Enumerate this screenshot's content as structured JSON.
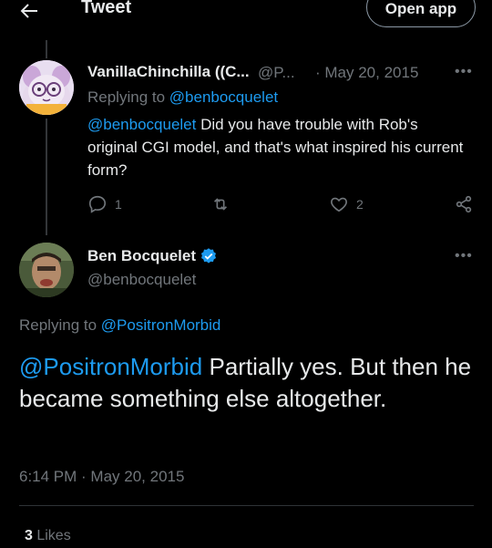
{
  "header": {
    "title": "Tweet",
    "open_app_label": "Open app"
  },
  "reply_tweet": {
    "author_name": "VanillaChinchilla ((C...",
    "author_handle": "@P...",
    "date": "· May 20, 2015",
    "replying_prefix": "Replying to ",
    "replying_to": "@benbocquelet",
    "text_mention": "@benbocquelet",
    "text_body": " Did you have trouble with Rob's original CGI model, and that's what inspired his current form?",
    "reply_count": "1",
    "like_count": "2"
  },
  "main_tweet": {
    "author_name": "Ben Bocquelet",
    "author_handle": "@benbocquelet",
    "replying_prefix": "Replying to ",
    "replying_to": "@PositronMorbid",
    "text_mention": "@PositronMorbid",
    "text_body": " Partially yes. But then he became something else altogether.",
    "timestamp": "6:14 PM · May 20, 2015",
    "likes_count": "3",
    "likes_label": " Likes"
  },
  "colors": {
    "background": "#000000",
    "link": "#1d9bf0",
    "muted": "#71767b",
    "text": "#e7e9ea"
  },
  "icons": {
    "back": "arrow-left-icon",
    "more": "more-horizontal-icon",
    "reply": "reply-bubble-icon",
    "retweet": "retweet-icon",
    "like": "heart-icon",
    "share": "share-icon",
    "verified": "verified-badge-icon"
  }
}
